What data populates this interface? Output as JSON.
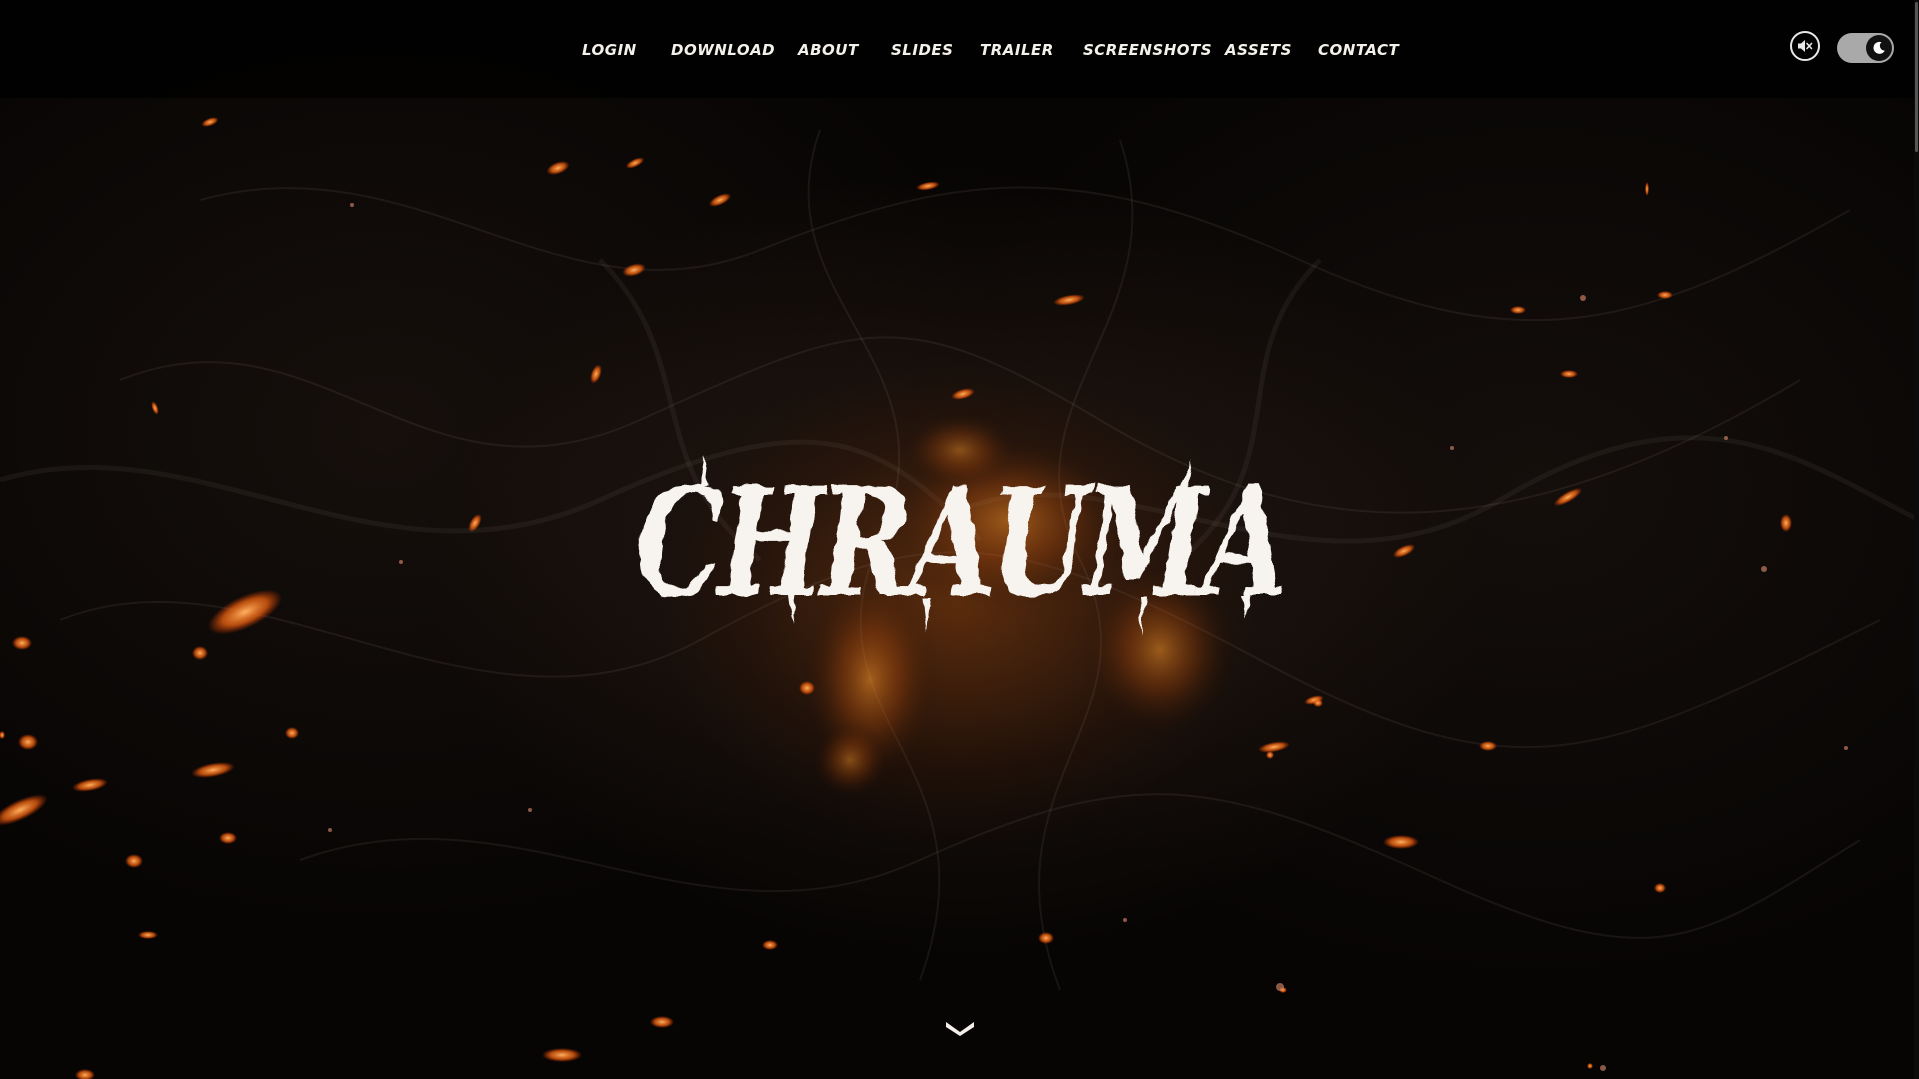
{
  "nav": {
    "items": [
      {
        "label": "Login"
      },
      {
        "label": "Download"
      },
      {
        "label": "About"
      },
      {
        "label": "Slides"
      },
      {
        "label": "Trailer"
      },
      {
        "label": "Screenshots"
      },
      {
        "label": "Assets"
      },
      {
        "label": "Contact"
      }
    ]
  },
  "controls": {
    "mute_icon": "speaker-muted-icon",
    "theme_icon": "moon-icon",
    "theme_mode": "dark"
  },
  "hero": {
    "logo_text": "CHRAUMA",
    "scroll_icon": "chevron-down-icon"
  },
  "colors": {
    "accent_ember": "#ff7a1a",
    "text": "#f4f0ea",
    "background": "#070504"
  }
}
